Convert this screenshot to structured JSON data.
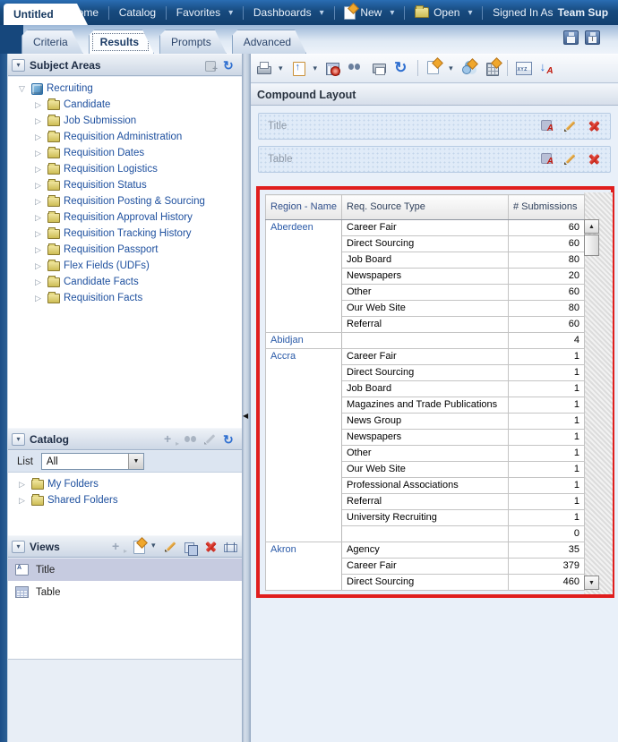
{
  "topnav": {
    "window_tab": "Untitled",
    "home": "Home",
    "catalog": "Catalog",
    "favorites": "Favorites",
    "dashboards": "Dashboards",
    "new_label": "New",
    "open_label": "Open",
    "signed_in_prefix": "Signed In As",
    "signed_in_user": "Team Sup"
  },
  "subtabs": {
    "tabs": [
      {
        "label": "Criteria",
        "active": false,
        "annotated": false
      },
      {
        "label": "Results",
        "active": true,
        "annotated": true
      },
      {
        "label": "Prompts",
        "active": false,
        "annotated": false
      },
      {
        "label": "Advanced",
        "active": false,
        "annotated": false
      }
    ]
  },
  "sidebar": {
    "subject_areas": {
      "title": "Subject Areas",
      "root": "Recruiting",
      "folders": [
        "Candidate",
        "Job Submission",
        "Requisition Administration",
        "Requisition Dates",
        "Requisition Logistics",
        "Requisition Status",
        "Requisition Posting & Sourcing",
        "Requisition Approval History",
        "Requisition Tracking History",
        "Requisition Passport",
        "Flex Fields (UDFs)",
        "Candidate Facts",
        "Requisition Facts"
      ]
    },
    "catalog": {
      "title": "Catalog",
      "list_label": "List",
      "list_value": "All",
      "folders": [
        "My Folders",
        "Shared Folders"
      ]
    },
    "views": {
      "title": "Views",
      "items": [
        {
          "label": "Title",
          "icon": "title",
          "selected": true
        },
        {
          "label": "Table",
          "icon": "table",
          "selected": false
        }
      ]
    }
  },
  "main": {
    "compound_layout_label": "Compound Layout",
    "view_bars": [
      {
        "label": "Title"
      },
      {
        "label": "Table"
      }
    ]
  },
  "results_table": {
    "type": "table",
    "columns": [
      "Region - Name",
      "Req. Source Type",
      "# Submissions"
    ],
    "groups": [
      {
        "region": "Aberdeen",
        "rows": [
          [
            "Career Fair",
            60
          ],
          [
            "Direct Sourcing",
            60
          ],
          [
            "Job Board",
            80
          ],
          [
            "Newspapers",
            20
          ],
          [
            "Other",
            60
          ],
          [
            "Our Web Site",
            80
          ],
          [
            "Referral",
            60
          ]
        ]
      },
      {
        "region": "Abidjan",
        "rows": [
          [
            "",
            4
          ]
        ]
      },
      {
        "region": "Accra",
        "rows": [
          [
            "Career Fair",
            1
          ],
          [
            "Direct Sourcing",
            1
          ],
          [
            "Job Board",
            1
          ],
          [
            "Magazines and Trade Publications",
            1
          ],
          [
            "News Group",
            1
          ],
          [
            "Newspapers",
            1
          ],
          [
            "Other",
            1
          ],
          [
            "Our Web Site",
            1
          ],
          [
            "Professional Associations",
            1
          ],
          [
            "Referral",
            1
          ],
          [
            "University Recruiting",
            1
          ],
          [
            "",
            0
          ]
        ]
      },
      {
        "region": "Akron",
        "rows": [
          [
            "Agency",
            35
          ],
          [
            "Career Fair",
            379
          ],
          [
            "Direct Sourcing",
            460
          ]
        ]
      }
    ]
  },
  "colors": {
    "annotation_red": "#e01e1e",
    "topbar_blue": "#174a7e",
    "link_blue": "#1d4f9e"
  }
}
